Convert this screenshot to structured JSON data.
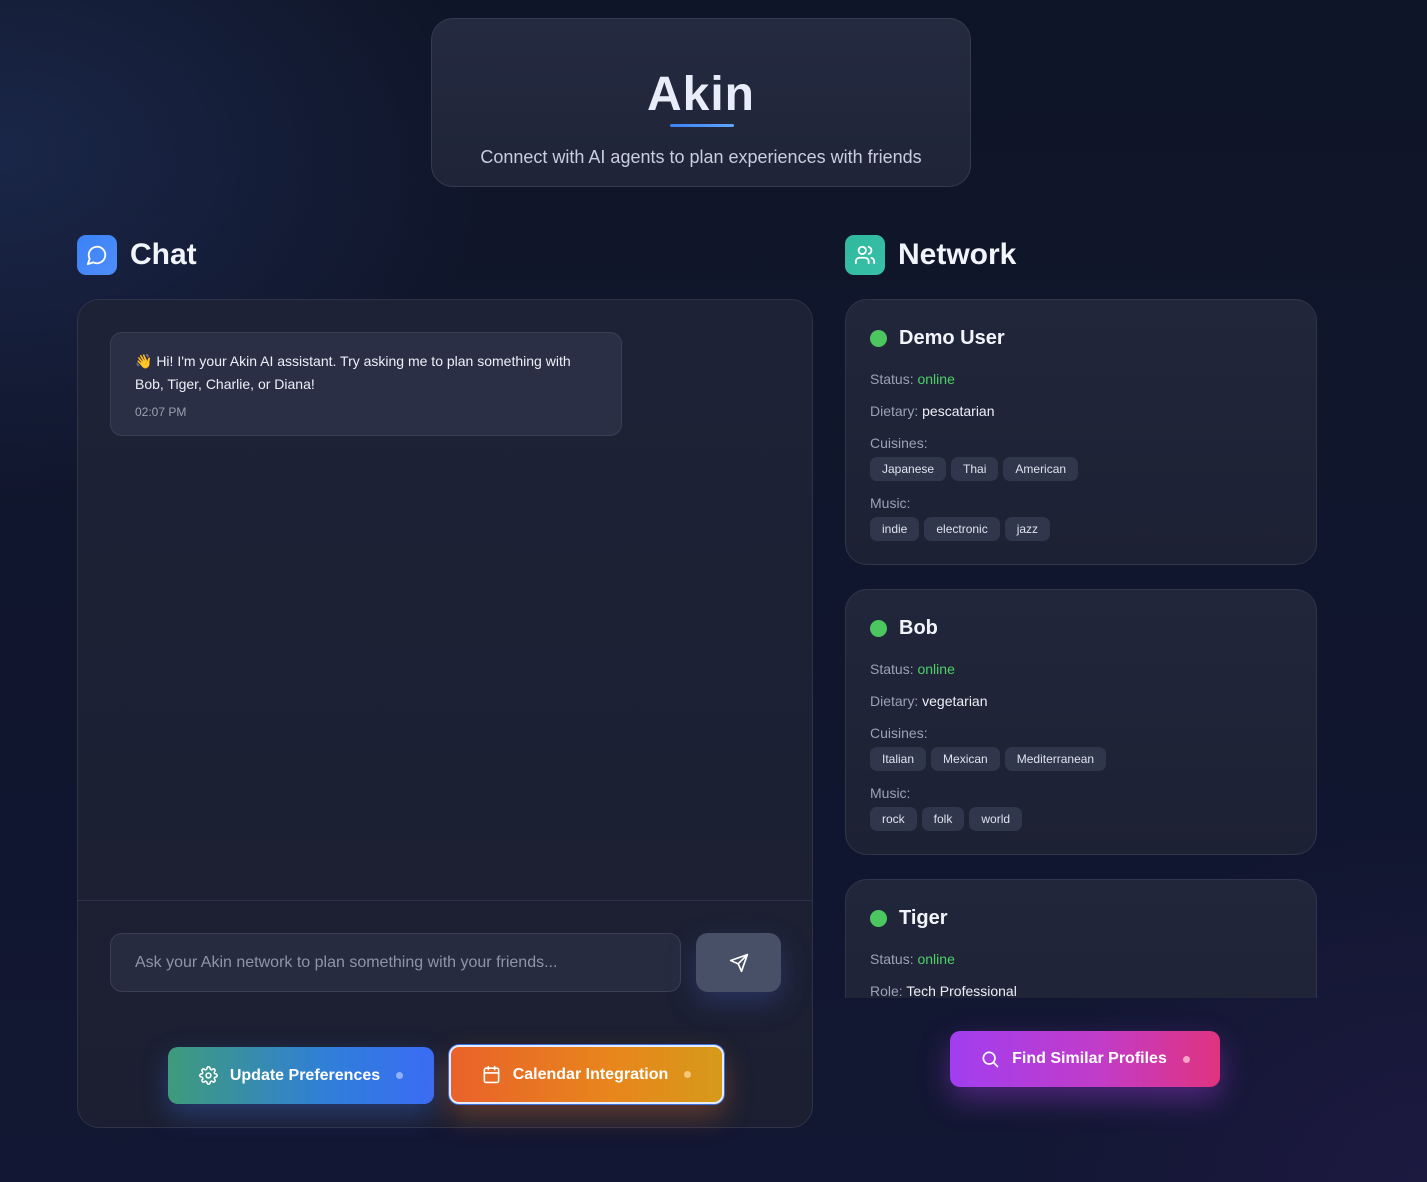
{
  "header": {
    "title": "Akin",
    "subtitle": "Connect with AI agents to plan experiences with friends"
  },
  "chat": {
    "heading": "Chat",
    "messages": [
      {
        "text": "👋 Hi! I'm your Akin AI assistant. Try asking me to plan something with Bob, Tiger, Charlie, or Diana!",
        "time": "02:07 PM"
      }
    ],
    "input_placeholder": "Ask your Akin network to plan something with your friends...",
    "buttons": {
      "update_preferences": "Update Preferences",
      "calendar_integration": "Calendar Integration"
    }
  },
  "network": {
    "heading": "Network",
    "status_label": "Status:",
    "dietary_label": "Dietary:",
    "cuisines_label": "Cuisines:",
    "music_label": "Music:",
    "role_label": "Role:",
    "profiles": [
      {
        "name": "Demo User",
        "status": "online",
        "dietary": "pescatarian",
        "cuisines": [
          "Japanese",
          "Thai",
          "American"
        ],
        "music": [
          "indie",
          "electronic",
          "jazz"
        ]
      },
      {
        "name": "Bob",
        "status": "online",
        "dietary": "vegetarian",
        "cuisines": [
          "Italian",
          "Mexican",
          "Mediterranean"
        ],
        "music": [
          "rock",
          "folk",
          "world"
        ]
      },
      {
        "name": "Tiger",
        "status": "online",
        "role": "Tech Professional"
      }
    ],
    "find_similar_button": "Find Similar Profiles"
  },
  "colors": {
    "online": "#4cc760",
    "chat_icon_bg": "#3b82f6",
    "network_icon_bg": "#2fb89c"
  },
  "icons": {
    "chat": "message-circle-icon",
    "network": "users-icon",
    "send": "send-icon",
    "settings": "gear-icon",
    "calendar": "calendar-icon",
    "search": "search-icon"
  }
}
